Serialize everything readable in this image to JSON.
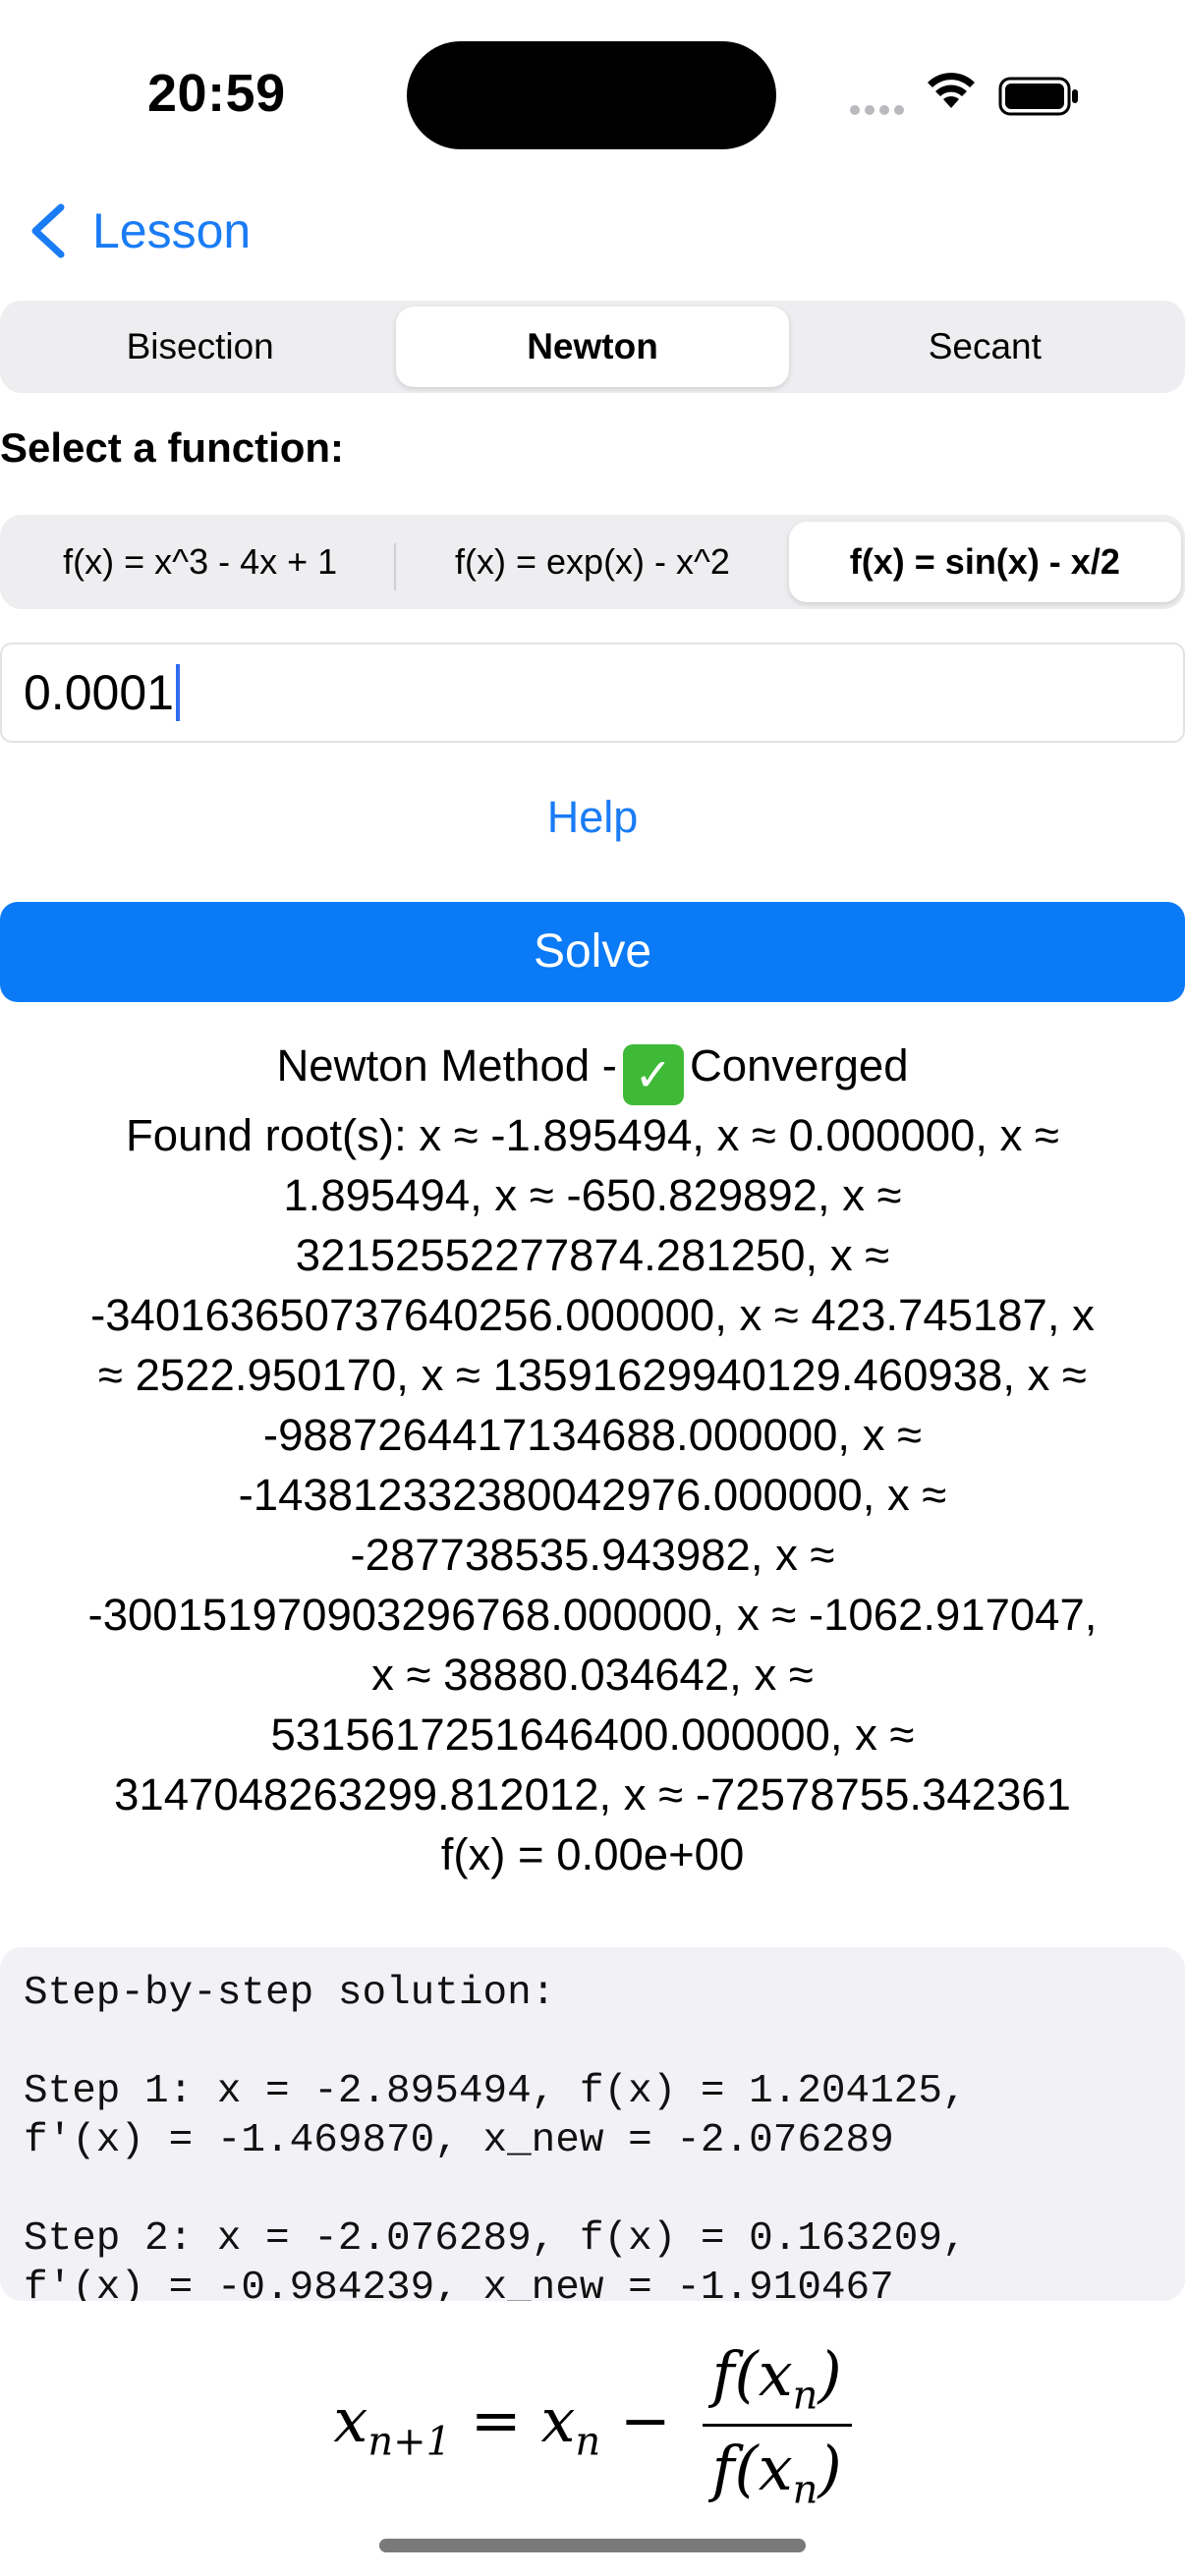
{
  "status_bar": {
    "time": "20:59"
  },
  "nav": {
    "back_label": "Lesson"
  },
  "method_tabs": [
    "Bisection",
    "Newton",
    "Secant"
  ],
  "method_selected": "Newton",
  "function_section": {
    "label": "Select a function:",
    "options": [
      "f(x) = x^3 - 4x + 1",
      "f(x) = exp(x) - x^2",
      "f(x) = sin(x) - x/2"
    ],
    "selected": "f(x) = sin(x) - x/2"
  },
  "tolerance": {
    "value": "0.0001"
  },
  "help_label": "Help",
  "solve_label": "Solve",
  "result": {
    "title_prefix": "Newton Method -",
    "title_status": "Converged",
    "lines": [
      "Found root(s): x ≈ -1.895494, x ≈ 0.000000, x ≈",
      "1.895494, x ≈ -650.829892, x ≈",
      "32152552277874.281250, x ≈",
      "-340163650737640256.000000, x ≈ 423.745187, x",
      "≈ 2522.950170, x ≈ 13591629940129.460938, x ≈",
      "-9887264417134688.000000, x ≈",
      "-143812332380042976.000000, x ≈",
      "-287738535.943982, x ≈",
      "-300151970903296768.000000, x ≈ -1062.917047,",
      "x ≈ 38880.034642, x ≈",
      "5315617251646400.000000, x ≈",
      "3147048263299.812012, x ≈ -72578755.342361",
      "f(x) = 0.00e+00"
    ]
  },
  "steps": {
    "text": "Step-by-step solution:\n\nStep 1: x = -2.895494, f(x) = 1.204125,\nf'(x) = -1.469870, x_new = -2.076289\n\nStep 2: x = -2.076289, f(x) = 0.163209,\nf'(x) = -0.984239, x_new = -1.910467"
  },
  "formula": {
    "lhs_base": "x",
    "lhs_sub": "n+1",
    "eq": "=",
    "rhs_base": "x",
    "rhs_sub": "n",
    "minus": "−",
    "num": "f(x",
    "num_sub": "n",
    "num_close": ")",
    "den": "f(x",
    "den_sub": "n",
    "den_close": ")"
  },
  "colors": {
    "accent": "#1a7cf5",
    "solve_button": "#0a7af7",
    "check": "#3fba37"
  }
}
